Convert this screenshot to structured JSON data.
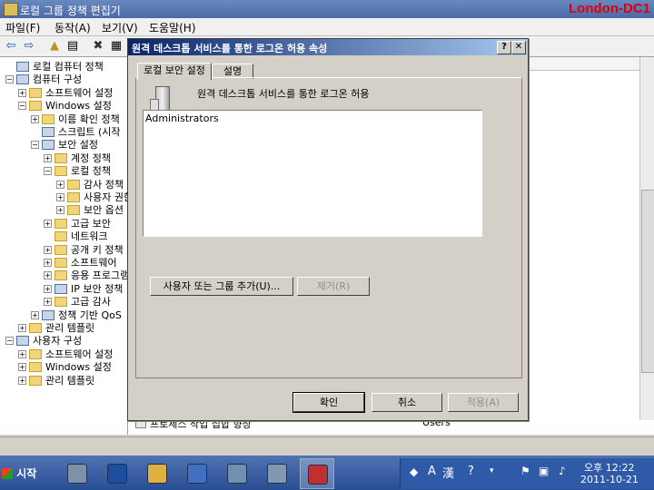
{
  "window": {
    "title": "로컬 그룹 정책 편집기",
    "watermark": "London-DC1"
  },
  "menu": [
    {
      "label": "파일(F)"
    },
    {
      "label": "동작(A)"
    },
    {
      "label": "보기(V)"
    },
    {
      "label": "도움말(H)"
    }
  ],
  "toolbar": [
    {
      "icon": "back-arrow-icon",
      "glyph": "⇦"
    },
    {
      "icon": "forward-arrow-icon",
      "glyph": "⇨"
    },
    {
      "icon": "up-folder-icon",
      "glyph": "▲"
    },
    {
      "icon": "show-hide-tree-icon",
      "glyph": "▤"
    },
    {
      "icon": "delete-icon",
      "glyph": "✖"
    },
    {
      "icon": "properties-icon",
      "glyph": "▦"
    }
  ],
  "tree": [
    {
      "label": "로컬 컴퓨터 정책",
      "depth": 0,
      "expander": "",
      "icon": "computer-policy-icon"
    },
    {
      "label": "컴퓨터 구성",
      "depth": 0,
      "expander": "−",
      "icon": "computer-icon"
    },
    {
      "label": "소프트웨어 설정",
      "depth": 1,
      "expander": "+",
      "icon": "folder-icon"
    },
    {
      "label": "Windows 설정",
      "depth": 1,
      "expander": "−",
      "icon": "folder-icon"
    },
    {
      "label": "이름 확인 정책",
      "depth": 2,
      "expander": "+",
      "icon": "folder-icon"
    },
    {
      "label": "스크립트 (시작",
      "depth": 2,
      "expander": "",
      "icon": "script-icon"
    },
    {
      "label": "보안 설정",
      "depth": 2,
      "expander": "−",
      "icon": "security-icon"
    },
    {
      "label": "계정 정책",
      "depth": 3,
      "expander": "+",
      "icon": "folder-icon"
    },
    {
      "label": "로컬 정책",
      "depth": 3,
      "expander": "−",
      "icon": "folder-icon"
    },
    {
      "label": "감사 정책",
      "depth": 4,
      "expander": "+",
      "icon": "folder-icon"
    },
    {
      "label": "사용자 권한",
      "depth": 4,
      "expander": "+",
      "icon": "folder-icon"
    },
    {
      "label": "보안 옵션",
      "depth": 4,
      "expander": "+",
      "icon": "folder-icon"
    },
    {
      "label": "고급 보안",
      "depth": 3,
      "expander": "+",
      "icon": "folder-icon"
    },
    {
      "label": "네트워크",
      "depth": 3,
      "expander": "",
      "icon": "folder-icon"
    },
    {
      "label": "공개 키 정책",
      "depth": 3,
      "expander": "+",
      "icon": "folder-icon"
    },
    {
      "label": "소프트웨어",
      "depth": 3,
      "expander": "+",
      "icon": "folder-icon"
    },
    {
      "label": "응용 프로그램",
      "depth": 3,
      "expander": "+",
      "icon": "folder-icon"
    },
    {
      "label": "IP 보안 정책",
      "depth": 3,
      "expander": "+",
      "icon": "ipsec-icon"
    },
    {
      "label": "고급 감사",
      "depth": 3,
      "expander": "+",
      "icon": "folder-icon"
    },
    {
      "label": "정책 기반 QoS",
      "depth": 2,
      "expander": "+",
      "icon": "chart-icon"
    },
    {
      "label": "관리 템플릿",
      "depth": 1,
      "expander": "+",
      "icon": "folder-icon"
    },
    {
      "label": "사용자 구성",
      "depth": 0,
      "expander": "−",
      "icon": "user-icon"
    },
    {
      "label": "소프트웨어 설정",
      "depth": 1,
      "expander": "+",
      "icon": "folder-icon"
    },
    {
      "label": "Windows 설정",
      "depth": 1,
      "expander": "+",
      "icon": "folder-icon"
    },
    {
      "label": "관리 템플릿",
      "depth": 1,
      "expander": "+",
      "icon": "folder-icon"
    }
  ],
  "right_pane": {
    "policy_row": {
      "name": "프로세스 작업 집합 향상",
      "value": "Users"
    }
  },
  "dialog": {
    "title": "원격 데스크톱 서비스를 통한 로그온 허용 속성",
    "help_glyph": "?",
    "close_glyph": "✕",
    "tabs": [
      {
        "label": "로컬 보안 설정"
      },
      {
        "label": "설명"
      }
    ],
    "policy_name": "원격 데스크톱 서비스를 통한 로그온 허용",
    "members": [
      "Administrators"
    ],
    "add_button": "사용자 또는 그룹 추가(U)...",
    "remove_button": "제거(R)",
    "ok_button": "확인",
    "cancel_button": "취소",
    "apply_button": "적용(A)"
  },
  "taskbar": {
    "start_label": "시작",
    "items": [
      {
        "icon": "server-manager-icon"
      },
      {
        "icon": "powershell-icon"
      },
      {
        "icon": "explorer-icon"
      },
      {
        "icon": "gpo-icon"
      },
      {
        "icon": "network-icon"
      },
      {
        "icon": "computer-mgmt-icon"
      },
      {
        "icon": "toolbox-icon"
      }
    ],
    "tray": {
      "ime_a": "A",
      "ime_han": "漢",
      "time": "오후 12:22",
      "date": "2011-10-21"
    }
  }
}
